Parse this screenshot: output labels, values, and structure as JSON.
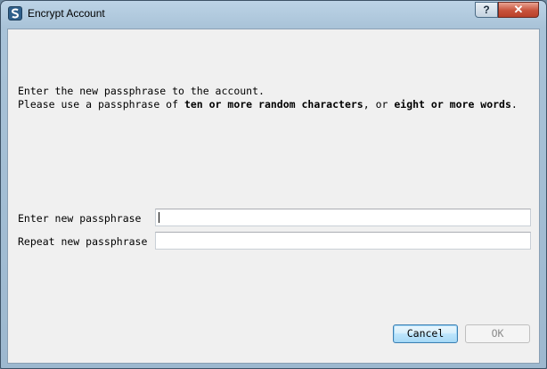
{
  "window": {
    "title": "Encrypt Account",
    "help_label": "?",
    "close_label": "✕"
  },
  "message": {
    "line1": "Enter the new passphrase to the account.",
    "line2_pre": "Please use a passphrase of ",
    "line2_bold1": "ten or more random characters",
    "line2_mid": ", or ",
    "line2_bold2": "eight or more words",
    "line2_end": "."
  },
  "form": {
    "new_label": "Enter new passphrase",
    "new_value": "",
    "repeat_label": "Repeat new passphrase",
    "repeat_value": ""
  },
  "buttons": {
    "cancel_label": "Cancel",
    "ok_label": "OK"
  }
}
